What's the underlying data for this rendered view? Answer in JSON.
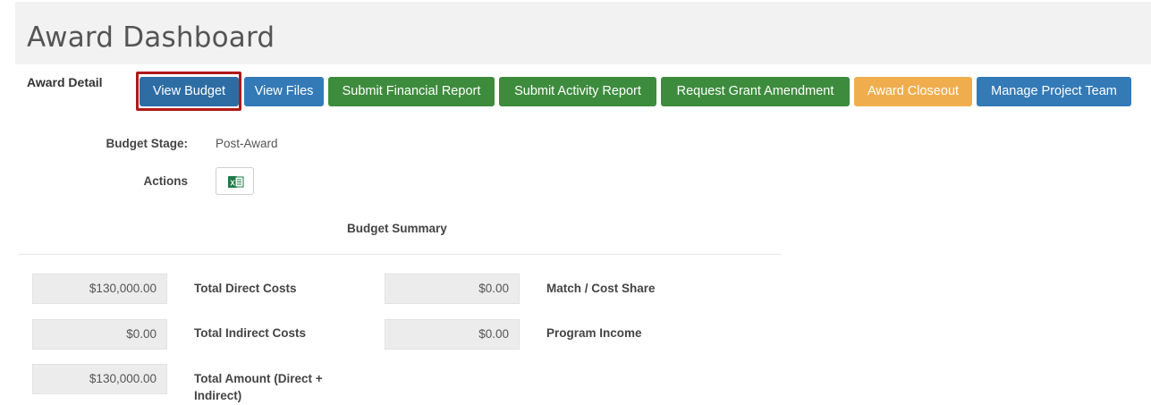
{
  "page": {
    "title": "Award Dashboard"
  },
  "tabs": {
    "active": "Award Detail"
  },
  "toolbar": {
    "view_budget": "View Budget",
    "view_files": "View Files",
    "submit_financial": "Submit Financial Report",
    "submit_activity": "Submit Activity Report",
    "request_amendment": "Request Grant Amendment",
    "award_closeout": "Award Closeout",
    "manage_team": "Manage Project Team"
  },
  "colors": {
    "blue": "#2e6da4",
    "green": "#3d8b3d",
    "orange": "#f0ad4e",
    "highlight": "#b01818"
  },
  "details": {
    "budget_stage_label": "Budget Stage:",
    "budget_stage_value": "Post-Award",
    "actions_label": "Actions",
    "export_icon": "excel-icon"
  },
  "summary": {
    "title": "Budget Summary",
    "total_direct_value": "$130,000.00",
    "total_direct_label": "Total Direct Costs",
    "total_indirect_value": "$0.00",
    "total_indirect_label": "Total Indirect Costs",
    "total_amount_value": "$130,000.00",
    "total_amount_label_line1": "Total Amount (Direct +",
    "total_amount_label_line2": "Indirect)",
    "match_value": "$0.00",
    "match_label": "Match / Cost Share",
    "program_income_value": "$0.00",
    "program_income_label": "Program Income"
  }
}
